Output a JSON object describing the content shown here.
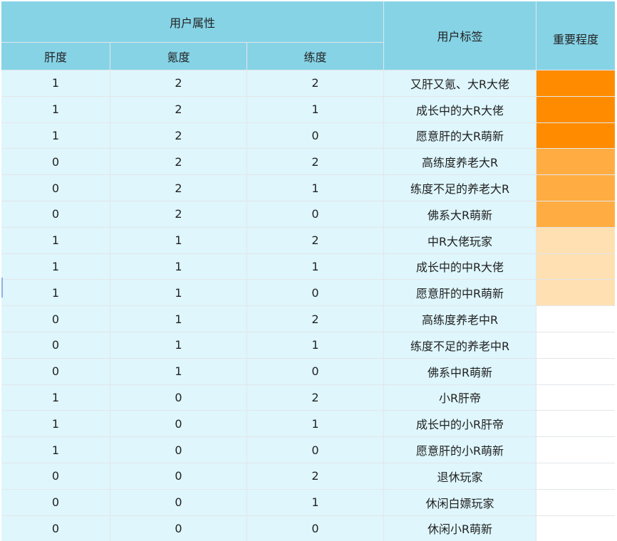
{
  "header": {
    "attributes_group": "用户属性",
    "columns": [
      "肝度",
      "氪度",
      "练度"
    ],
    "tag": "用户标签",
    "importance": "重要程度"
  },
  "colors": {
    "high": "#ff8c00",
    "medium": "#ffad42",
    "low": "#ffe0b2",
    "none": "#ffffff"
  },
  "rows": [
    {
      "gan": "1",
      "ke": "2",
      "lian": "2",
      "tag": "又肝又氪、大R大佬",
      "level": "high"
    },
    {
      "gan": "1",
      "ke": "2",
      "lian": "1",
      "tag": "成长中的大R大佬",
      "level": "high"
    },
    {
      "gan": "1",
      "ke": "2",
      "lian": "0",
      "tag": "愿意肝的大R萌新",
      "level": "high"
    },
    {
      "gan": "0",
      "ke": "2",
      "lian": "2",
      "tag": "高练度养老大R",
      "level": "medium"
    },
    {
      "gan": "0",
      "ke": "2",
      "lian": "1",
      "tag": "练度不足的养老大R",
      "level": "medium"
    },
    {
      "gan": "0",
      "ke": "2",
      "lian": "0",
      "tag": "佛系大R萌新",
      "level": "medium"
    },
    {
      "gan": "1",
      "ke": "1",
      "lian": "2",
      "tag": "中R大佬玩家",
      "level": "low"
    },
    {
      "gan": "1",
      "ke": "1",
      "lian": "1",
      "tag": "成长中的中R大佬",
      "level": "low"
    },
    {
      "gan": "1",
      "ke": "1",
      "lian": "0",
      "tag": "愿意肝的中R萌新",
      "level": "low"
    },
    {
      "gan": "0",
      "ke": "1",
      "lian": "2",
      "tag": "高练度养老中R",
      "level": "none"
    },
    {
      "gan": "0",
      "ke": "1",
      "lian": "1",
      "tag": "练度不足的养老中R",
      "level": "none"
    },
    {
      "gan": "0",
      "ke": "1",
      "lian": "0",
      "tag": "佛系中R萌新",
      "level": "none"
    },
    {
      "gan": "1",
      "ke": "0",
      "lian": "2",
      "tag": "小R肝帝",
      "level": "none"
    },
    {
      "gan": "1",
      "ke": "0",
      "lian": "1",
      "tag": "成长中的小R肝帝",
      "level": "none"
    },
    {
      "gan": "1",
      "ke": "0",
      "lian": "0",
      "tag": "愿意肝的小R萌新",
      "level": "none"
    },
    {
      "gan": "0",
      "ke": "0",
      "lian": "2",
      "tag": "退休玩家",
      "level": "none"
    },
    {
      "gan": "0",
      "ke": "0",
      "lian": "1",
      "tag": "休闲白嫖玩家",
      "level": "none"
    },
    {
      "gan": "0",
      "ke": "0",
      "lian": "0",
      "tag": "休闲小R萌新",
      "level": "none"
    }
  ]
}
